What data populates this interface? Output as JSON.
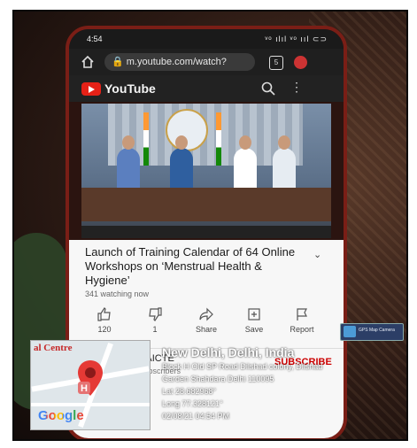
{
  "phone": {
    "status": {
      "time": "4:54",
      "icons": "ᵛᵒ ılıl ᵛᵒ ııl ⊂⊃"
    },
    "browser": {
      "url": "m.youtube.com/watch?",
      "tab_count": "5"
    },
    "youtube": {
      "brand": "YouTube",
      "video_title": "Launch of Training Calendar of 64 Online Workshops on ‘Menstrual Health & Hygiene’",
      "watching": "341 watching now",
      "actions": [
        {
          "label": "120",
          "icon": "thumbs-up-icon"
        },
        {
          "label": "1",
          "icon": "thumbs-down-icon"
        },
        {
          "label": "Share",
          "icon": "share-icon"
        },
        {
          "label": "Save",
          "icon": "save-icon"
        },
        {
          "label": "Report",
          "icon": "flag-icon"
        }
      ],
      "channel": {
        "name": "Media AICTE",
        "subscribers": "26.6K subscribers",
        "subscribe_label": "SUBSCRIBE"
      }
    }
  },
  "gps_overlay": {
    "map_label": "al Centre",
    "google": "Google",
    "city": "New Delhi, Delhi, India",
    "address_line1": "Block H Old SP Road Dilshad colony, Dilshad",
    "address_line2": "Garden Shahdara Delhi 110095",
    "lat": "Lat 28.682968°",
    "long": "Long 77.328121°",
    "datetime": "02/08/21 04:54 PM",
    "badge": "GPS Map Camera"
  },
  "colors": {
    "youtube_red": "#e62117",
    "subscribe_red": "#cc0000",
    "phone_case": "#7a1e16"
  }
}
